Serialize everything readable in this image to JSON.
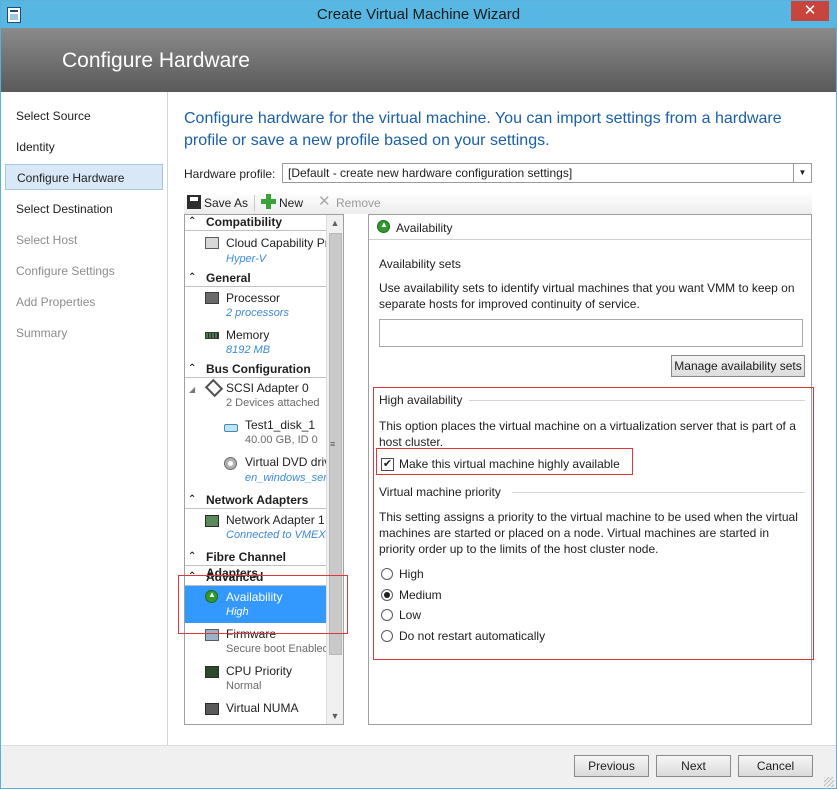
{
  "window": {
    "title": "Create Virtual Machine Wizard",
    "close_glyph": "✕"
  },
  "banner": {
    "title": "Configure Hardware"
  },
  "nav": {
    "items": [
      {
        "label": "Select Source",
        "state": "normal"
      },
      {
        "label": "Identity",
        "state": "normal"
      },
      {
        "label": "Configure Hardware",
        "state": "active"
      },
      {
        "label": "Select Destination",
        "state": "normal"
      },
      {
        "label": "Select Host",
        "state": "disabled"
      },
      {
        "label": "Configure Settings",
        "state": "disabled"
      },
      {
        "label": "Add Properties",
        "state": "disabled"
      },
      {
        "label": "Summary",
        "state": "disabled"
      }
    ]
  },
  "main": {
    "intro": "Configure hardware for the virtual machine. You can import settings from a hardware profile or save a new profile based on your settings.",
    "hardware_profile_label": "Hardware profile:",
    "hardware_profile_value": "[Default - create new hardware configuration settings]",
    "dropdown_glyph": "▼"
  },
  "toolbar": {
    "save_as": "Save As",
    "new": "New",
    "remove": "Remove",
    "remove_glyph": "✕"
  },
  "tree": {
    "chevron": "⌃",
    "sections": {
      "compatibility": "Compatibility",
      "general": "General",
      "bus": "Bus Configuration",
      "network": "Network Adapters",
      "fibre": "Fibre Channel Adapters",
      "advanced": "Advanced"
    },
    "items": {
      "cloud": {
        "name": "Cloud Capability Pr...",
        "sub": "Hyper-V"
      },
      "processor": {
        "name": "Processor",
        "sub": "2 processors"
      },
      "memory": {
        "name": "Memory",
        "sub": "8192 MB"
      },
      "scsi": {
        "name": "SCSI Adapter 0",
        "sub": "2 Devices attached",
        "expander": "◢"
      },
      "disk": {
        "name": "Test1_disk_1",
        "sub": "40.00 GB, ID 0"
      },
      "dvd": {
        "name": "Virtual DVD drive",
        "sub": "en_windows_ser..."
      },
      "netadapter": {
        "name": "Network Adapter 1",
        "sub": "Connected to VMEX..."
      },
      "availability": {
        "name": "Availability",
        "sub": "High"
      },
      "firmware": {
        "name": "Firmware",
        "sub": "Secure boot Enabled"
      },
      "cpupriority": {
        "name": "CPU Priority",
        "sub": "Normal"
      },
      "numa": {
        "name": "Virtual NUMA",
        "sub": ""
      }
    },
    "scroll_up": "▲",
    "scroll_down": "▼",
    "scroll_grip": "≡"
  },
  "detail": {
    "header": "Availability",
    "availability_sets_title": "Availability sets",
    "availability_sets_text": "Use availability sets to identify virtual machines that you want VMM to keep on separate hosts for improved continuity of service.",
    "manage_button": "Manage availability sets",
    "high_availability_title": "High availability",
    "high_availability_text": "This option places the virtual machine on a virtualization server that is part of a host cluster.",
    "highly_available_label": "Make this virtual machine highly available",
    "highly_available_checked": true,
    "check_glyph": "✔",
    "priority_title": "Virtual machine priority",
    "priority_text": "This setting assigns a priority to the virtual machine to be used when the virtual machines are started or placed on a node. Virtual machines are started in priority order up to the limits of the host cluster node.",
    "priority_options": [
      "High",
      "Medium",
      "Low",
      "Do not restart automatically"
    ],
    "priority_selected": "Medium"
  },
  "footer": {
    "previous": "Previous",
    "next": "Next",
    "cancel": "Cancel"
  },
  "colors": {
    "titlebar": "#58b7e2",
    "accent_text": "#1a5fa8",
    "selection": "#3399ff",
    "highlight_box": "#e0353a"
  }
}
